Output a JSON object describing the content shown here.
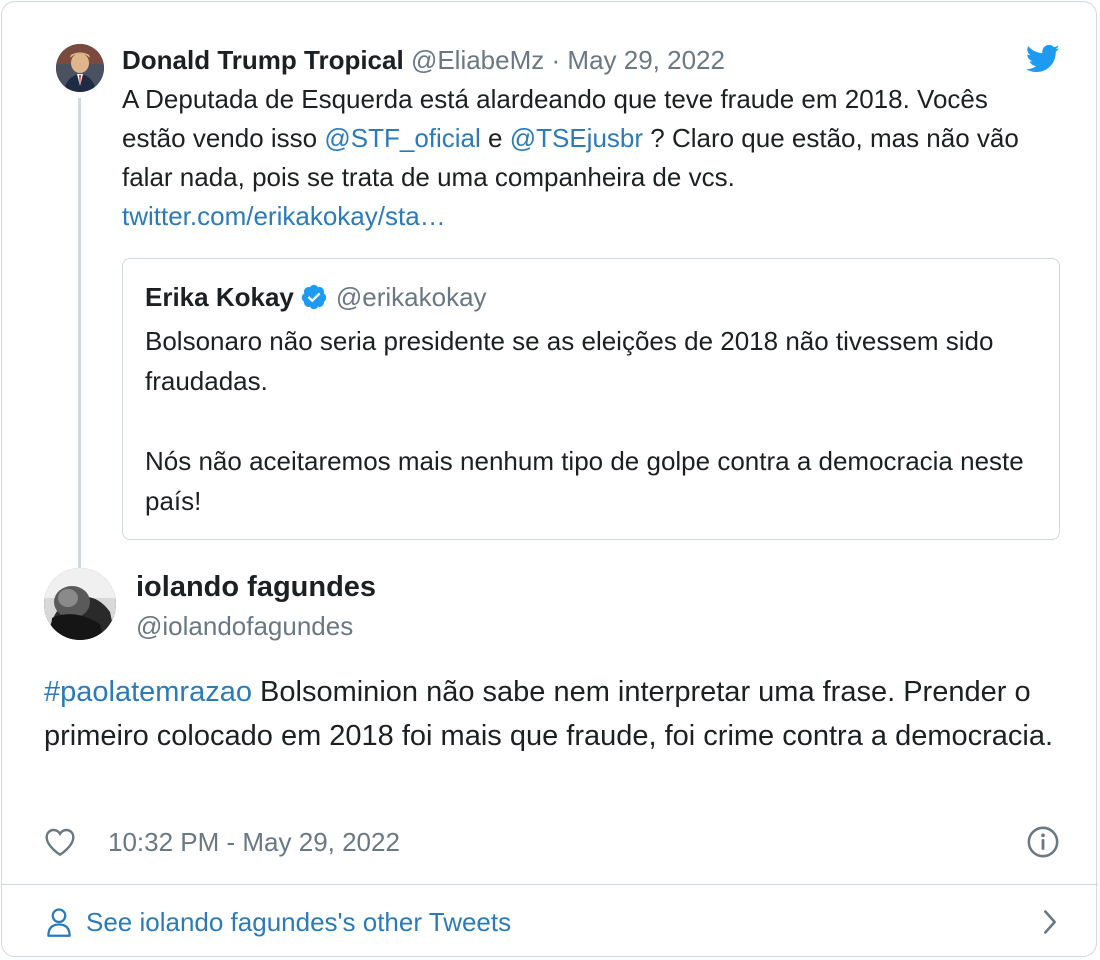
{
  "parent_tweet": {
    "name": "Donald Trump Tropical",
    "handle": "@EliabeMz",
    "separator": "·",
    "date": "May 29, 2022",
    "text_part1": "A Deputada de Esquerda está alardeando que teve fraude em 2018. Vocês estão vendo isso ",
    "mention1": "@STF_oficial",
    "text_part2": "  e ",
    "mention2": "@TSEjusbr",
    "text_part3": " ? Claro que estão, mas não vão falar nada, pois se trata de uma companheira de vcs. ",
    "link": "twitter.com/erikakokay/sta…"
  },
  "quoted_tweet": {
    "name": "Erika Kokay",
    "handle": "@erikakokay",
    "paragraph1": "Bolsonaro não seria presidente se as eleições de 2018 não tivessem sido fraudadas.",
    "paragraph2": "Nós não aceitaremos mais nenhum tipo de golpe contra a democracia neste país!"
  },
  "main_tweet": {
    "name": "iolando fagundes",
    "handle": "@iolandofagundes",
    "hashtag": "#paolatemrazao",
    "text": " Bolsominion não sabe nem interpretar uma frase. Prender o primeiro colocado em 2018 foi mais que fraude, foi crime contra a democracia.",
    "timestamp": "10:32 PM - May 29, 2022"
  },
  "footer": {
    "label": "See iolando fagundes's other Tweets"
  },
  "icons": {
    "brand": "twitter-bird-icon",
    "verified": "verified-badge-icon",
    "like": "heart-icon",
    "info": "info-icon",
    "person": "person-icon",
    "chevron": "chevron-right-icon"
  },
  "colors": {
    "link": "#2b7bb9",
    "twitter_blue": "#1d9bf0",
    "muted": "#697882",
    "border": "#cfd9de",
    "text": "#1c2022"
  }
}
